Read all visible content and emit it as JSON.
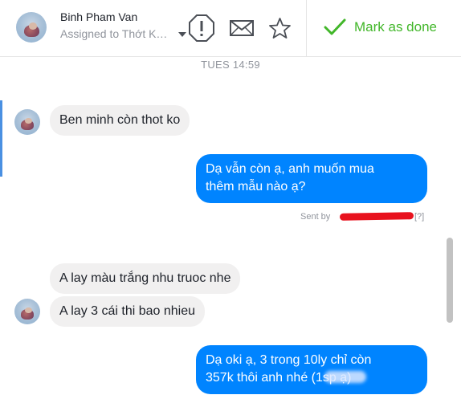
{
  "header": {
    "contact_name": "Binh Pham Van",
    "assigned_to": "Assigned to Thớt K…",
    "mark_done_label": "Mark as done",
    "icons": [
      "alert-icon",
      "mail-icon",
      "star-icon",
      "checkmark-icon"
    ],
    "accent_color": "#42b72a"
  },
  "conversation": {
    "timestamp": "TUES 14:59",
    "messages": [
      {
        "direction": "incoming",
        "text": "Ben minh còn thot ko"
      },
      {
        "direction": "outgoing",
        "lines": [
          "Dạ vẫn còn ạ, anh muốn mua",
          "thêm mẫu nào ạ?"
        ]
      },
      {
        "direction": "incoming",
        "text": "A lay màu trắng nhu truoc nhe"
      },
      {
        "direction": "incoming",
        "text": "A lay 3 cái thi bao nhieu"
      },
      {
        "direction": "outgoing",
        "lines": [
          "Dạ oki ạ, 3 trong 10ly chỉ còn",
          "357k thôi anh nhé (1sp ạ)"
        ]
      }
    ],
    "sent_by_label": "Sent by",
    "help_link": "[?]",
    "outgoing_color": "#0084ff",
    "incoming_color": "#f1f0f0"
  }
}
